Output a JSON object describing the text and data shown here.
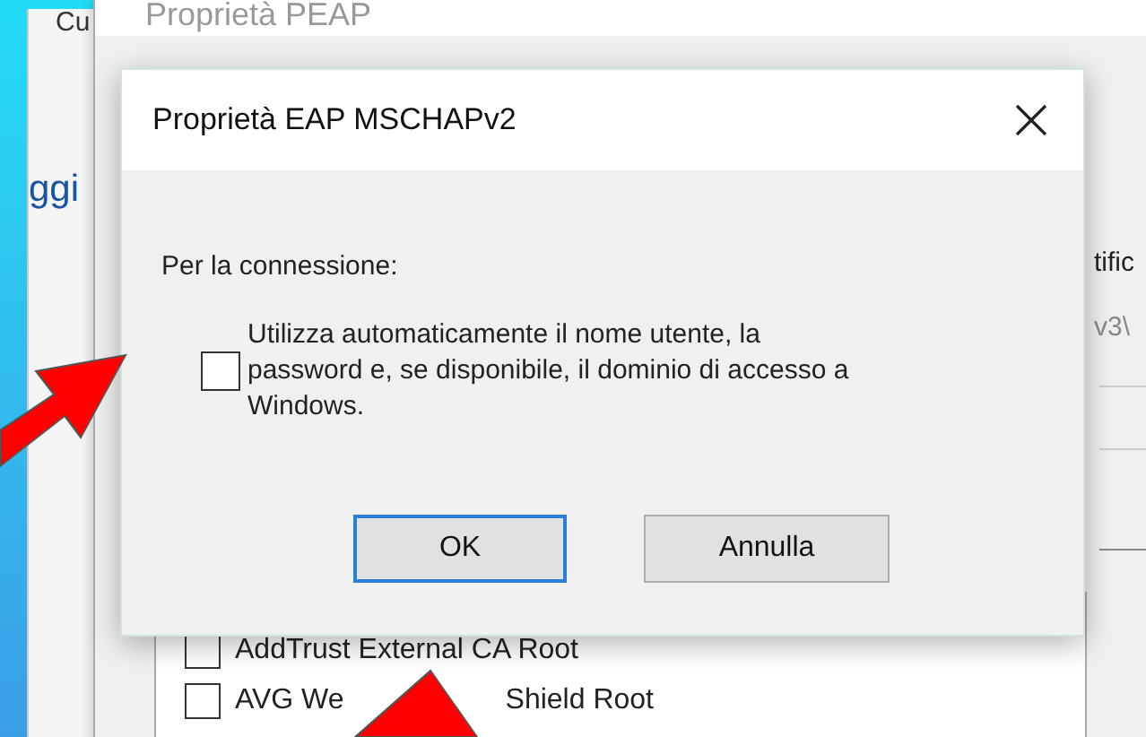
{
  "back_window": {
    "title_fragment": "Cu",
    "link_fragment": "ggi"
  },
  "peap_window": {
    "title": "Proprietà PEAP",
    "text_fragments": [
      "tific",
      "v3\\"
    ],
    "certificates": [
      {
        "label_parts": [
          "AddTrust External CA Root"
        ],
        "checked": false
      },
      {
        "label_parts": [
          "AVG We",
          "Shield Root"
        ],
        "checked": false
      }
    ]
  },
  "dialog": {
    "title": "Proprietà EAP MSCHAPv2",
    "section_label": "Per la connessione:",
    "option": {
      "label_lines": [
        "Utilizza automaticamente il nome utente, la",
        "password e, se disponibile, il dominio di accesso a",
        "Windows."
      ],
      "checked": false
    },
    "buttons": [
      {
        "label": "OK",
        "default": true
      },
      {
        "label": "Annulla",
        "default": false
      }
    ]
  }
}
